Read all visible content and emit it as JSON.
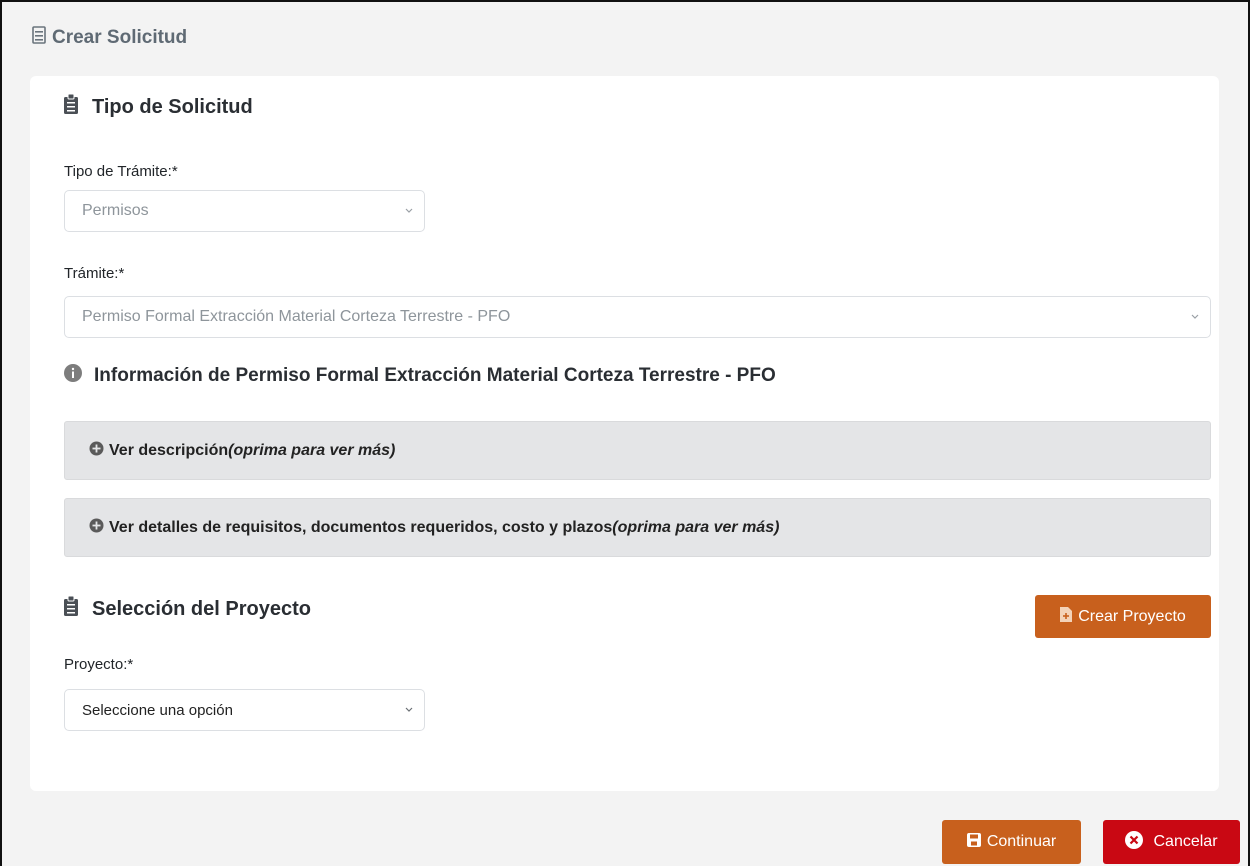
{
  "page": {
    "title": "Crear Solicitud"
  },
  "tipo_solicitud": {
    "heading": "Tipo de Solicitud",
    "tipo_tramite_label": "Tipo de Trámite:*",
    "tipo_tramite_value": "Permisos",
    "tramite_label": "Trámite:*",
    "tramite_value": "Permiso Formal Extracción Material Corteza Terrestre - PFO"
  },
  "info": {
    "heading": "Información de Permiso Formal Extracción Material Corteza Terrestre - PFO",
    "accordion_descripcion": {
      "label": "Ver descripción",
      "hint": "(oprima para ver más)"
    },
    "accordion_detalles": {
      "label": "Ver detalles de requisitos, documentos requeridos, costo y plazos",
      "hint": "(oprima para ver más)"
    }
  },
  "proyecto": {
    "heading": "Selección del Proyecto",
    "crear_button": "Crear Proyecto",
    "label": "Proyecto:*",
    "select_value": "Seleccione una opción"
  },
  "actions": {
    "continuar": "Continuar",
    "cancelar": "Cancelar"
  },
  "colors": {
    "accent_orange": "#c8601d",
    "danger_red": "#c90813",
    "panel_gray": "#e4e5e7"
  },
  "icons": [
    "document-icon",
    "clipboard-icon",
    "info-icon",
    "plus-circle-icon",
    "chevron-down-icon",
    "file-plus-icon",
    "save-icon",
    "close-circle-icon"
  ]
}
